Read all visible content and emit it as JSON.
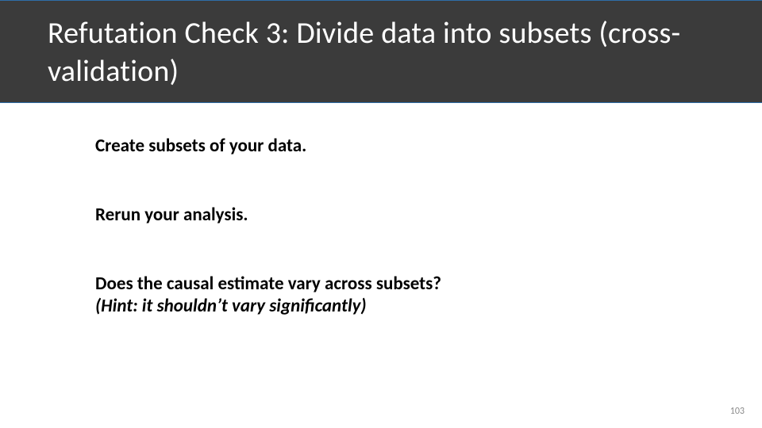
{
  "slide": {
    "title": "Refutation Check 3: Divide data into subsets (cross-validation)",
    "bullets": {
      "line1": "Create subsets of your data.",
      "line2": "Rerun your analysis.",
      "line3a": "Does the causal estimate vary across subsets?",
      "line3b": "(Hint: it shouldn’t vary significantly)"
    },
    "page_number": "103"
  }
}
